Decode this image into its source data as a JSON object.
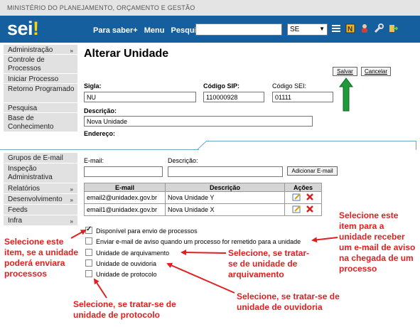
{
  "header": {
    "ministry": "MINISTÉRIO DO PLANEJAMENTO, ORÇAMENTO E GESTÃO",
    "logo": "sei",
    "logo_mark": "!",
    "nav": [
      "Para saber+",
      "Menu",
      "Pesquisa"
    ],
    "search_value": "",
    "unit_select": "SE",
    "tool_icons": [
      "list-icon",
      "notes-icon",
      "user-icon",
      "wrench-icon",
      "exit-icon"
    ]
  },
  "sidebar_top": [
    {
      "label": "Administração",
      "caret": "»"
    },
    {
      "label": "Controle de Processos",
      "caret": ""
    },
    {
      "label": "Iniciar Processo",
      "caret": ""
    },
    {
      "label": "Retorno Programado",
      "caret": ""
    },
    {
      "label": "Pesquisa",
      "caret": ""
    },
    {
      "label": "Base de Conhecimento",
      "caret": ""
    }
  ],
  "sidebar_bottom": [
    {
      "label": "Grupos de E-mail",
      "caret": ""
    },
    {
      "label": "Inspeção Administrativa",
      "caret": ""
    },
    {
      "label": "Relatórios",
      "caret": "»"
    },
    {
      "label": "Desenvolvimento",
      "caret": "»"
    },
    {
      "label": "Feeds",
      "caret": ""
    },
    {
      "label": "Infra",
      "caret": "»"
    }
  ],
  "form": {
    "title": "Alterar Unidade",
    "save_label": "Salvar",
    "cancel_label": "Cancelar",
    "sigla_label": "Sigla:",
    "sigla_value": "NU",
    "codigo_sip_label": "Código SIP:",
    "codigo_sip_value": "110000928",
    "codigo_sei_label": "Código SEI:",
    "codigo_sei_value": "01111",
    "descricao_label": "Descrição:",
    "descricao_value": "Nova Unidade",
    "endereco_label": "Endereço:",
    "email_label": "E-mail:",
    "email_value": "",
    "email_desc_label": "Descrição:",
    "email_desc_value": "",
    "add_email_label": "Adicionar E-mail"
  },
  "emails_table": {
    "headers": [
      "E-mail",
      "Descrição",
      "Ações"
    ],
    "rows": [
      {
        "email": "email2@unidadex.gov.br",
        "descricao": "Nova Unidade Y"
      },
      {
        "email": "email1@unidadex.gov.br",
        "descricao": "Nova Unidade X"
      }
    ]
  },
  "options": [
    {
      "label": "Disponível para envio de processos",
      "checked": true
    },
    {
      "label": "Enviar e-mail de aviso quando um processo for remetido para a unidade",
      "checked": false
    },
    {
      "label": "Unidade de arquivamento",
      "checked": false
    },
    {
      "label": "Unidade de ouvidoria",
      "checked": false
    },
    {
      "label": "Unidade de protocolo",
      "checked": false
    }
  ],
  "annotations": {
    "envio": "Selecione este item, se a unidade poderá enviara processos",
    "aviso": "Selecione este item para a unidade receber um e-mail de aviso na chegada de um processo",
    "arquivamento": "Selecione, se tratar-se de unidade de arquivamento",
    "ouvidoria": "Selecione, se tratar-se de unidade de ouvidoria",
    "protocolo": "Selecione, se tratar-se de unidade de protocolo"
  },
  "colors": {
    "header_blue": "#155f9e",
    "annotation_red": "#e02020",
    "save_arrow_green": "#1e9a3a"
  }
}
